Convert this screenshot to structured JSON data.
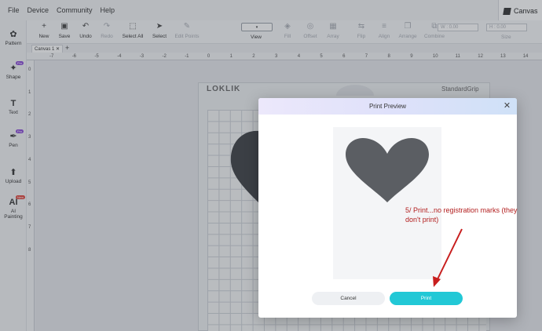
{
  "menu": {
    "items": [
      "File",
      "Device",
      "Community",
      "Help"
    ]
  },
  "document_tab": {
    "label": "Canvas"
  },
  "toolbar": {
    "new": "New",
    "save": "Save",
    "undo": "Undo",
    "redo": "Redo",
    "select_all": "Select All",
    "select": "Select",
    "edit_points": "Edit Points",
    "view": "View",
    "view_value": "",
    "fill": "Fill",
    "offset": "Offset",
    "array": "Array",
    "flip": "Flip",
    "align": "Align",
    "arrange": "Arrange",
    "combine": "Combine",
    "width_field": "W : 0.00",
    "height_field": "H : 0.00",
    "size": "Size"
  },
  "left_panel": {
    "pattern": "Pattern",
    "shape": "Shape",
    "text": "Text",
    "pen": "Pen",
    "upload": "Upload",
    "ai": "AI",
    "ai_painting": "AI\nPainting",
    "badge_pro": "Pro",
    "badge_new": "New"
  },
  "canvas_tab": {
    "label": "Canvas 1 ✕",
    "add": "+"
  },
  "ruler": {
    "h_ticks": [
      "-7",
      "-6",
      "-5",
      "-4",
      "-3",
      "-2",
      "-1",
      "0",
      "1",
      "2",
      "3",
      "4",
      "5",
      "6",
      "7",
      "8",
      "9",
      "10",
      "11",
      "12",
      "13",
      "14"
    ],
    "v_ticks": [
      "0",
      "1",
      "2",
      "3",
      "4",
      "5",
      "6",
      "7",
      "8"
    ]
  },
  "mat": {
    "logo": "LOKLIK",
    "grip": "StandardGrip"
  },
  "modal": {
    "title": "Print Preview",
    "cancel": "Cancel",
    "print": "Print"
  },
  "annotation": "5/ Print...no registration marks (they don't print)",
  "colors": {
    "accent": "#22c8d6",
    "shape": "#5b5e63",
    "annotation": "#b32020"
  }
}
